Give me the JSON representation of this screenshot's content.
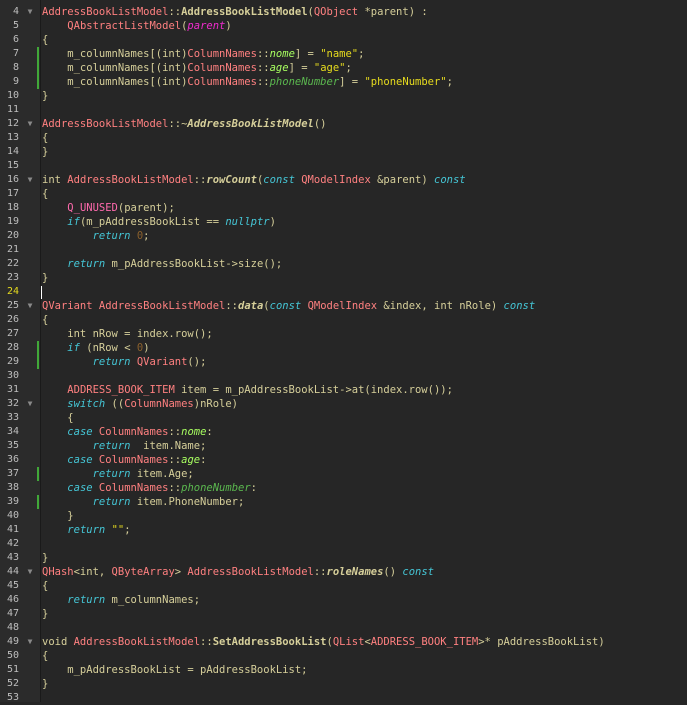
{
  "editor": {
    "current_line": "24",
    "colors": {
      "background": "#262626",
      "text": "#d6cf9a",
      "type": "#ff8080",
      "keyword": "#45c6d6",
      "string": "#e6db1e",
      "enum_value": "#a8ff60",
      "change_marker": "#41a839"
    },
    "lines": [
      {
        "n": "4",
        "fold": true,
        "mark": false,
        "tokens": [
          [
            "type",
            "AddressBookListModel"
          ],
          [
            "plain",
            "::"
          ],
          [
            "fnb",
            "AddressBookListModel"
          ],
          [
            "plain",
            "("
          ],
          [
            "type",
            "QObject"
          ],
          [
            "plain",
            " *parent) :"
          ]
        ]
      },
      {
        "n": "5",
        "fold": false,
        "mark": false,
        "tokens": [
          [
            "plain",
            "    "
          ],
          [
            "type",
            "QAbstractListModel"
          ],
          [
            "plain",
            "("
          ],
          [
            "mem",
            "parent"
          ],
          [
            "plain",
            ")"
          ]
        ]
      },
      {
        "n": "6",
        "fold": false,
        "mark": false,
        "tokens": [
          [
            "plain",
            "{"
          ]
        ]
      },
      {
        "n": "7",
        "fold": false,
        "mark": true,
        "tokens": [
          [
            "plain",
            "    m_columnNames[("
          ],
          [
            "plain",
            "int"
          ],
          [
            "plain",
            ")"
          ],
          [
            "type",
            "ColumnNames"
          ],
          [
            "plain",
            "::"
          ],
          [
            "enumv",
            "nome"
          ],
          [
            "plain",
            "] = "
          ],
          [
            "str",
            "\"name\""
          ],
          [
            "plain",
            ";"
          ]
        ]
      },
      {
        "n": "8",
        "fold": false,
        "mark": true,
        "tokens": [
          [
            "plain",
            "    m_columnNames[("
          ],
          [
            "plain",
            "int"
          ],
          [
            "plain",
            ")"
          ],
          [
            "type",
            "ColumnNames"
          ],
          [
            "plain",
            "::"
          ],
          [
            "enumv",
            "age"
          ],
          [
            "plain",
            "] = "
          ],
          [
            "str",
            "\"age\""
          ],
          [
            "plain",
            ";"
          ]
        ]
      },
      {
        "n": "9",
        "fold": false,
        "mark": true,
        "tokens": [
          [
            "plain",
            "    m_columnNames[("
          ],
          [
            "plain",
            "int"
          ],
          [
            "plain",
            ")"
          ],
          [
            "type",
            "ColumnNames"
          ],
          [
            "plain",
            "::"
          ],
          [
            "enumv2",
            "phoneNumber"
          ],
          [
            "plain",
            "] = "
          ],
          [
            "str",
            "\"phoneNumber\""
          ],
          [
            "plain",
            ";"
          ]
        ]
      },
      {
        "n": "10",
        "fold": false,
        "mark": false,
        "tokens": [
          [
            "plain",
            "}"
          ]
        ]
      },
      {
        "n": "11",
        "fold": false,
        "mark": false,
        "tokens": []
      },
      {
        "n": "12",
        "fold": true,
        "mark": false,
        "tokens": [
          [
            "type",
            "AddressBookListModel"
          ],
          [
            "plain",
            "::~"
          ],
          [
            "fn",
            "AddressBookListModel"
          ],
          [
            "plain",
            "()"
          ]
        ]
      },
      {
        "n": "13",
        "fold": false,
        "mark": false,
        "tokens": [
          [
            "plain",
            "{"
          ]
        ]
      },
      {
        "n": "14",
        "fold": false,
        "mark": false,
        "tokens": [
          [
            "plain",
            "}"
          ]
        ]
      },
      {
        "n": "15",
        "fold": false,
        "mark": false,
        "tokens": []
      },
      {
        "n": "16",
        "fold": true,
        "mark": false,
        "tokens": [
          [
            "plain",
            "int "
          ],
          [
            "type",
            "AddressBookListModel"
          ],
          [
            "plain",
            "::"
          ],
          [
            "fn",
            "rowCount"
          ],
          [
            "plain",
            "("
          ],
          [
            "kw",
            "const"
          ],
          [
            "plain",
            " "
          ],
          [
            "type",
            "QModelIndex"
          ],
          [
            "plain",
            " &parent) "
          ],
          [
            "kw",
            "const"
          ]
        ]
      },
      {
        "n": "17",
        "fold": false,
        "mark": false,
        "tokens": [
          [
            "plain",
            "{"
          ]
        ]
      },
      {
        "n": "18",
        "fold": false,
        "mark": false,
        "tokens": [
          [
            "plain",
            "    "
          ],
          [
            "mac",
            "Q_UNUSED"
          ],
          [
            "plain",
            "(parent);"
          ]
        ]
      },
      {
        "n": "19",
        "fold": false,
        "mark": false,
        "tokens": [
          [
            "plain",
            "    "
          ],
          [
            "kw",
            "if"
          ],
          [
            "plain",
            "(m_pAddressBookList == "
          ],
          [
            "null",
            "nullptr"
          ],
          [
            "plain",
            ")"
          ]
        ]
      },
      {
        "n": "20",
        "fold": false,
        "mark": false,
        "tokens": [
          [
            "plain",
            "        "
          ],
          [
            "kw",
            "return"
          ],
          [
            "plain",
            " "
          ],
          [
            "num",
            "0"
          ],
          [
            "plain",
            ";"
          ]
        ]
      },
      {
        "n": "21",
        "fold": false,
        "mark": false,
        "tokens": []
      },
      {
        "n": "22",
        "fold": false,
        "mark": false,
        "tokens": [
          [
            "plain",
            "    "
          ],
          [
            "kw",
            "return"
          ],
          [
            "plain",
            " m_pAddressBookList->size();"
          ]
        ]
      },
      {
        "n": "23",
        "fold": false,
        "mark": false,
        "tokens": [
          [
            "plain",
            "}"
          ]
        ]
      },
      {
        "n": "24",
        "fold": false,
        "mark": false,
        "tokens": []
      },
      {
        "n": "25",
        "fold": true,
        "mark": false,
        "tokens": [
          [
            "type",
            "QVariant"
          ],
          [
            "plain",
            " "
          ],
          [
            "type",
            "AddressBookListModel"
          ],
          [
            "plain",
            "::"
          ],
          [
            "fn",
            "data"
          ],
          [
            "plain",
            "("
          ],
          [
            "kw",
            "const"
          ],
          [
            "plain",
            " "
          ],
          [
            "type",
            "QModelIndex"
          ],
          [
            "plain",
            " &index, int nRole) "
          ],
          [
            "kw",
            "const"
          ]
        ]
      },
      {
        "n": "26",
        "fold": false,
        "mark": false,
        "tokens": [
          [
            "plain",
            "{"
          ]
        ]
      },
      {
        "n": "27",
        "fold": false,
        "mark": false,
        "tokens": [
          [
            "plain",
            "    int nRow = index.row();"
          ]
        ]
      },
      {
        "n": "28",
        "fold": false,
        "mark": true,
        "tokens": [
          [
            "plain",
            "    "
          ],
          [
            "kw",
            "if"
          ],
          [
            "plain",
            " (nRow < "
          ],
          [
            "num",
            "0"
          ],
          [
            "plain",
            ")"
          ]
        ]
      },
      {
        "n": "29",
        "fold": false,
        "mark": true,
        "tokens": [
          [
            "plain",
            "        "
          ],
          [
            "kw",
            "return"
          ],
          [
            "plain",
            " "
          ],
          [
            "type",
            "QVariant"
          ],
          [
            "plain",
            "();"
          ]
        ]
      },
      {
        "n": "30",
        "fold": false,
        "mark": false,
        "tokens": []
      },
      {
        "n": "31",
        "fold": false,
        "mark": false,
        "tokens": [
          [
            "plain",
            "    "
          ],
          [
            "type",
            "ADDRESS_BOOK_ITEM"
          ],
          [
            "plain",
            " item = m_pAddressBookList->at(index.row());"
          ]
        ]
      },
      {
        "n": "32",
        "fold": true,
        "mark": false,
        "tokens": [
          [
            "plain",
            "    "
          ],
          [
            "kw",
            "switch"
          ],
          [
            "plain",
            " (("
          ],
          [
            "type",
            "ColumnNames"
          ],
          [
            "plain",
            ")nRole)"
          ]
        ]
      },
      {
        "n": "33",
        "fold": false,
        "mark": false,
        "tokens": [
          [
            "plain",
            "    {"
          ]
        ]
      },
      {
        "n": "34",
        "fold": false,
        "mark": false,
        "tokens": [
          [
            "plain",
            "    "
          ],
          [
            "kw",
            "case"
          ],
          [
            "plain",
            " "
          ],
          [
            "type",
            "ColumnNames"
          ],
          [
            "plain",
            "::"
          ],
          [
            "enumv",
            "nome"
          ],
          [
            "plain",
            ":"
          ]
        ]
      },
      {
        "n": "35",
        "fold": false,
        "mark": false,
        "tokens": [
          [
            "plain",
            "        "
          ],
          [
            "kw",
            "return"
          ],
          [
            "plain",
            "  item.Name;"
          ]
        ]
      },
      {
        "n": "36",
        "fold": false,
        "mark": false,
        "tokens": [
          [
            "plain",
            "    "
          ],
          [
            "kw",
            "case"
          ],
          [
            "plain",
            " "
          ],
          [
            "type",
            "ColumnNames"
          ],
          [
            "plain",
            "::"
          ],
          [
            "enumv",
            "age"
          ],
          [
            "plain",
            ":"
          ]
        ]
      },
      {
        "n": "37",
        "fold": false,
        "mark": true,
        "tokens": [
          [
            "plain",
            "        "
          ],
          [
            "kw",
            "return"
          ],
          [
            "plain",
            " item.Age;"
          ]
        ]
      },
      {
        "n": "38",
        "fold": false,
        "mark": false,
        "tokens": [
          [
            "plain",
            "    "
          ],
          [
            "kw",
            "case"
          ],
          [
            "plain",
            " "
          ],
          [
            "type",
            "ColumnNames"
          ],
          [
            "plain",
            "::"
          ],
          [
            "enumv2",
            "phoneNumber"
          ],
          [
            "plain",
            ":"
          ]
        ]
      },
      {
        "n": "39",
        "fold": false,
        "mark": true,
        "tokens": [
          [
            "plain",
            "        "
          ],
          [
            "kw",
            "return"
          ],
          [
            "plain",
            " item.PhoneNumber;"
          ]
        ]
      },
      {
        "n": "40",
        "fold": false,
        "mark": false,
        "tokens": [
          [
            "plain",
            "    }"
          ]
        ]
      },
      {
        "n": "41",
        "fold": false,
        "mark": false,
        "tokens": [
          [
            "plain",
            "    "
          ],
          [
            "kw",
            "return"
          ],
          [
            "plain",
            " "
          ],
          [
            "str",
            "\"\""
          ],
          [
            "plain",
            ";"
          ]
        ]
      },
      {
        "n": "42",
        "fold": false,
        "mark": false,
        "tokens": []
      },
      {
        "n": "43",
        "fold": false,
        "mark": false,
        "tokens": [
          [
            "plain",
            "}"
          ]
        ]
      },
      {
        "n": "44",
        "fold": true,
        "mark": false,
        "tokens": []
      },
      {
        "n": "44",
        "fold": true,
        "mark": false,
        "tokens": [
          [
            "type",
            "QHash"
          ],
          [
            "plain",
            "<int, "
          ],
          [
            "type",
            "QByteArray"
          ],
          [
            "plain",
            "> "
          ],
          [
            "type",
            "AddressBookListModel"
          ],
          [
            "plain",
            "::"
          ],
          [
            "fn",
            "roleNames"
          ],
          [
            "plain",
            "() "
          ],
          [
            "kw",
            "const"
          ]
        ]
      },
      {
        "n": "45",
        "fold": false,
        "mark": false,
        "tokens": [
          [
            "plain",
            "{"
          ]
        ]
      },
      {
        "n": "46",
        "fold": false,
        "mark": false,
        "tokens": [
          [
            "plain",
            "    "
          ],
          [
            "kw",
            "return"
          ],
          [
            "plain",
            " m_columnNames;"
          ]
        ]
      },
      {
        "n": "47",
        "fold": false,
        "mark": false,
        "tokens": [
          [
            "plain",
            "}"
          ]
        ]
      },
      {
        "n": "48",
        "fold": false,
        "mark": false,
        "tokens": []
      },
      {
        "n": "49",
        "fold": true,
        "mark": false,
        "tokens": [
          [
            "plain",
            "void "
          ],
          [
            "type",
            "AddressBookListModel"
          ],
          [
            "plain",
            "::"
          ],
          [
            "fnb",
            "SetAddressBookList"
          ],
          [
            "plain",
            "("
          ],
          [
            "type",
            "QList"
          ],
          [
            "plain",
            "<"
          ],
          [
            "type",
            "ADDRESS_BOOK_ITEM"
          ],
          [
            "plain",
            ">* pAddressBookList)"
          ]
        ]
      },
      {
        "n": "50",
        "fold": false,
        "mark": false,
        "tokens": [
          [
            "plain",
            "{"
          ]
        ]
      },
      {
        "n": "51",
        "fold": false,
        "mark": false,
        "tokens": [
          [
            "plain",
            "    m_pAddressBookList = pAddressBookList;"
          ]
        ]
      },
      {
        "n": "52",
        "fold": false,
        "mark": false,
        "tokens": [
          [
            "plain",
            "}"
          ]
        ]
      },
      {
        "n": "53",
        "fold": false,
        "mark": false,
        "tokens": []
      }
    ]
  }
}
